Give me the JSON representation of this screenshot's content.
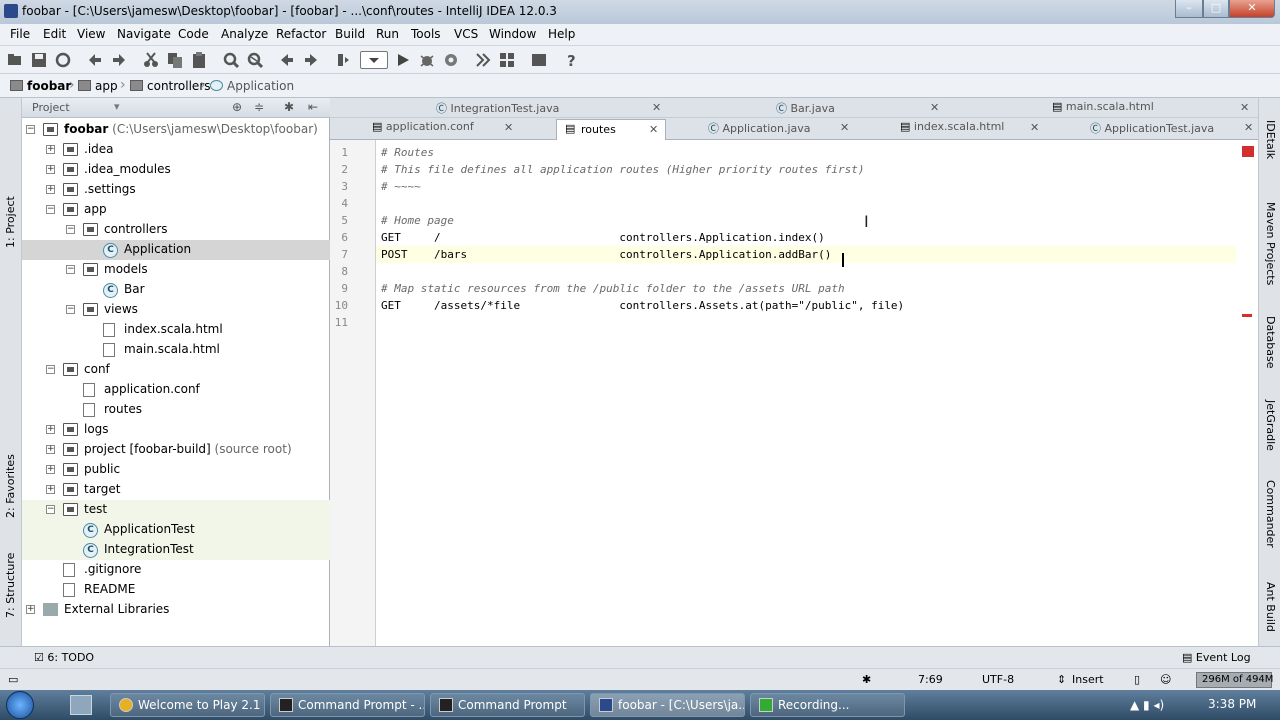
{
  "window": {
    "title": "foobar - [C:\\Users\\jamesw\\Desktop\\foobar] - [foobar] - ...\\conf\\routes - IntelliJ IDEA 12.0.3"
  },
  "menu": [
    "File",
    "Edit",
    "View",
    "Navigate",
    "Code",
    "Analyze",
    "Refactor",
    "Build",
    "Run",
    "Tools",
    "VCS",
    "Window",
    "Help"
  ],
  "breadcrumb": [
    "foobar",
    "app",
    "controllers",
    "Application"
  ],
  "left_tool_windows": [
    "1: Project",
    "2: Favorites",
    "7: Structure"
  ],
  "right_tool_windows": [
    "IDEtalk",
    "Maven Projects",
    "Database",
    "JetGradle",
    "Commander",
    "Ant Build"
  ],
  "project_panel": {
    "title": "Project",
    "tree": [
      {
        "label": "foobar",
        "extra": " (C:\\Users\\jamesw\\Desktop\\foobar)",
        "depth": 0,
        "icon": "folder-icon",
        "toggle": "−"
      },
      {
        "label": ".idea",
        "depth": 1,
        "icon": "folder-icon",
        "toggle": "+"
      },
      {
        "label": ".idea_modules",
        "depth": 1,
        "icon": "folder-icon",
        "toggle": "+"
      },
      {
        "label": ".settings",
        "depth": 1,
        "icon": "folder-icon",
        "toggle": "+"
      },
      {
        "label": "app",
        "depth": 1,
        "icon": "folder-icon",
        "toggle": "−"
      },
      {
        "label": "controllers",
        "depth": 2,
        "icon": "package-icon",
        "toggle": "−"
      },
      {
        "label": "Application",
        "depth": 3,
        "icon": "class-icon",
        "selected": true
      },
      {
        "label": "models",
        "depth": 2,
        "icon": "package-icon",
        "toggle": "−"
      },
      {
        "label": "Bar",
        "depth": 3,
        "icon": "class-icon"
      },
      {
        "label": "views",
        "depth": 2,
        "icon": "package-icon",
        "toggle": "−"
      },
      {
        "label": "index.scala.html",
        "depth": 3,
        "icon": "file-icon"
      },
      {
        "label": "main.scala.html",
        "depth": 3,
        "icon": "file-icon"
      },
      {
        "label": "conf",
        "depth": 1,
        "icon": "folder-icon",
        "toggle": "−"
      },
      {
        "label": "application.conf",
        "depth": 2,
        "icon": "file-icon"
      },
      {
        "label": "routes",
        "depth": 2,
        "icon": "file-icon"
      },
      {
        "label": "logs",
        "depth": 1,
        "icon": "folder-icon",
        "toggle": "+"
      },
      {
        "label": "project [foobar-build]",
        "extra": " (source root)",
        "depth": 1,
        "icon": "folder-icon",
        "toggle": "+"
      },
      {
        "label": "public",
        "depth": 1,
        "icon": "folder-icon",
        "toggle": "+"
      },
      {
        "label": "target",
        "depth": 1,
        "icon": "folder-icon",
        "toggle": "+"
      },
      {
        "label": "test",
        "depth": 1,
        "icon": "folder-icon",
        "toggle": "−",
        "highlight": true
      },
      {
        "label": "ApplicationTest",
        "depth": 2,
        "icon": "test-class-icon",
        "highlight": true
      },
      {
        "label": "IntegrationTest",
        "depth": 2,
        "icon": "test-class-icon",
        "highlight": true
      },
      {
        "label": ".gitignore",
        "depth": 1,
        "icon": "file-icon"
      },
      {
        "label": "README",
        "depth": 1,
        "icon": "file-icon"
      },
      {
        "label": "External Libraries",
        "depth": 0,
        "icon": "library-icon",
        "toggle": "+"
      }
    ]
  },
  "tabs_row1": [
    {
      "label": "IntegrationTest.java",
      "icon": "class-icon"
    },
    {
      "label": "Bar.java",
      "icon": "class-icon"
    },
    {
      "label": "main.scala.html",
      "icon": "file-icon"
    }
  ],
  "tabs_row2": [
    {
      "label": "application.conf",
      "icon": "file-icon"
    },
    {
      "label": "routes",
      "icon": "file-icon",
      "active": true
    },
    {
      "label": "Application.java",
      "icon": "class-icon"
    },
    {
      "label": "index.scala.html",
      "icon": "file-icon"
    },
    {
      "label": "ApplicationTest.java",
      "icon": "class-icon"
    }
  ],
  "editor": {
    "lines": [
      {
        "n": "1",
        "text": "# Routes",
        "comment": true
      },
      {
        "n": "2",
        "text": "# This file defines all application routes (Higher priority routes first)",
        "comment": true
      },
      {
        "n": "3",
        "text": "# ~~~~",
        "comment": true
      },
      {
        "n": "4",
        "text": ""
      },
      {
        "n": "5",
        "text": "# Home page",
        "comment": true
      },
      {
        "n": "6",
        "text": "GET     /                           controllers.Application.index()"
      },
      {
        "n": "7",
        "text": "POST    /bars                       controllers.Application.addBar()"
      },
      {
        "n": "8",
        "text": ""
      },
      {
        "n": "9",
        "text": "# Map static resources from the /public folder to the /assets URL path",
        "comment": true
      },
      {
        "n": "10",
        "text": "GET     /assets/*file               controllers.Assets.at(path=\"/public\", file)"
      },
      {
        "n": "11",
        "text": ""
      }
    ]
  },
  "status": {
    "todo": "6: TODO",
    "event_log": "Event Log",
    "position": "7:69",
    "encoding": "UTF-8",
    "mode": "Insert",
    "memory": "296M of 494M"
  },
  "taskbar": {
    "items": [
      "Welcome to Play 2.1 ...",
      "Command Prompt - ...",
      "Command Prompt",
      "foobar - [C:\\Users\\ja...",
      "Recording..."
    ],
    "time": "3:38 PM"
  },
  "colors": {
    "accent": "#2b4a8c",
    "selection": "#d5d5d5",
    "caret_line": "#ffffe4",
    "error_marker": "#d32f2f"
  }
}
